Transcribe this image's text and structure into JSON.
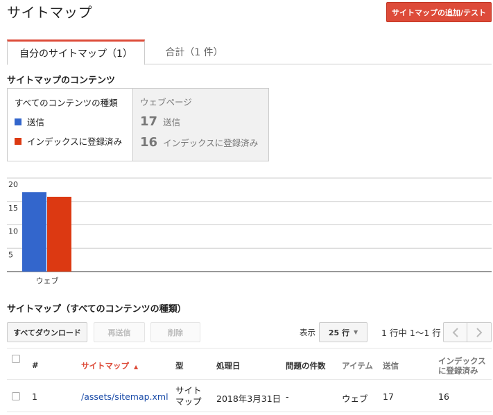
{
  "header": {
    "title": "サイトマップ",
    "add_button": "サイトマップの追加/テスト"
  },
  "tabs": [
    {
      "label": "自分のサイトマップ（1）",
      "active": true
    },
    {
      "label": "合計（1 件）",
      "active": false
    }
  ],
  "contents": {
    "heading": "サイトマップのコンテンツ",
    "legend_title": "すべてのコンテンツの種類",
    "legend": [
      {
        "label": "送信",
        "color": "#3366cc"
      },
      {
        "label": "インデックスに登録済み",
        "color": "#dc3912"
      }
    ],
    "stats_title": "ウェブページ",
    "stats": [
      {
        "value": "17",
        "label": "送信"
      },
      {
        "value": "16",
        "label": "インデックスに登録済み"
      }
    ]
  },
  "chart_data": {
    "type": "bar",
    "categories": [
      "ウェブ"
    ],
    "series": [
      {
        "name": "送信",
        "values": [
          17
        ],
        "color": "#3366cc"
      },
      {
        "name": "インデックスに登録済み",
        "values": [
          16
        ],
        "color": "#dc3912"
      }
    ],
    "ylim": [
      0,
      20
    ],
    "yticks": [
      "20",
      "15",
      "10",
      "5"
    ],
    "grid": true
  },
  "sitemaps": {
    "heading": "サイトマップ（すべてのコンテンツの種類）",
    "download_button": "すべてダウンロード",
    "resubmit_button": "再送信",
    "delete_button": "削除",
    "show_label": "表示",
    "rows_select": "25 行",
    "pagination_text": "1 行中 1〜1 行",
    "columns": {
      "num": "#",
      "sitemap": "サイトマップ",
      "type": "型",
      "processed": "処理日",
      "issues": "問題の件数",
      "items": "アイテム",
      "submitted": "送信",
      "indexed": "インデックスに登録済み"
    },
    "rows": [
      {
        "num": "1",
        "sitemap": "/assets/sitemap.xml",
        "type": "サイトマップ",
        "processed": "2018年3月31日",
        "issues": "-",
        "items": "ウェブ",
        "submitted": "17",
        "indexed": "16"
      }
    ]
  }
}
